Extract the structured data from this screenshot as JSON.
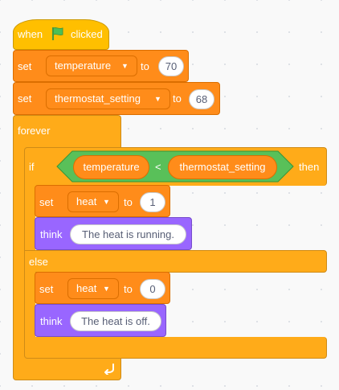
{
  "script": {
    "hat": {
      "label_when": "when",
      "label_clicked": "clicked",
      "flag_icon": "green-flag-icon"
    },
    "set_temperature": {
      "label_set": "set",
      "variable": "temperature",
      "label_to": "to",
      "value": "70"
    },
    "set_thermostat": {
      "label_set": "set",
      "variable": "thermostat_setting",
      "label_to": "to",
      "value": "68"
    },
    "forever": {
      "label": "forever",
      "loop_icon": "loop-arrow-icon"
    },
    "if_else": {
      "label_if": "if",
      "label_then": "then",
      "label_else": "else",
      "condition": {
        "left": "temperature",
        "operator": "<",
        "right": "thermostat_setting"
      }
    },
    "set_heat_on": {
      "label_set": "set",
      "variable": "heat",
      "label_to": "to",
      "value": "1"
    },
    "think_on": {
      "label": "think",
      "message": "The heat is running."
    },
    "set_heat_off": {
      "label_set": "set",
      "variable": "heat",
      "label_to": "to",
      "value": "0"
    },
    "think_off": {
      "label": "think",
      "message": "The heat is off."
    }
  },
  "colors": {
    "events": "#FFBF00",
    "control": "#FFAB19",
    "variables": "#FF8C1A",
    "looks": "#9966FF",
    "operators": "#59C059"
  }
}
